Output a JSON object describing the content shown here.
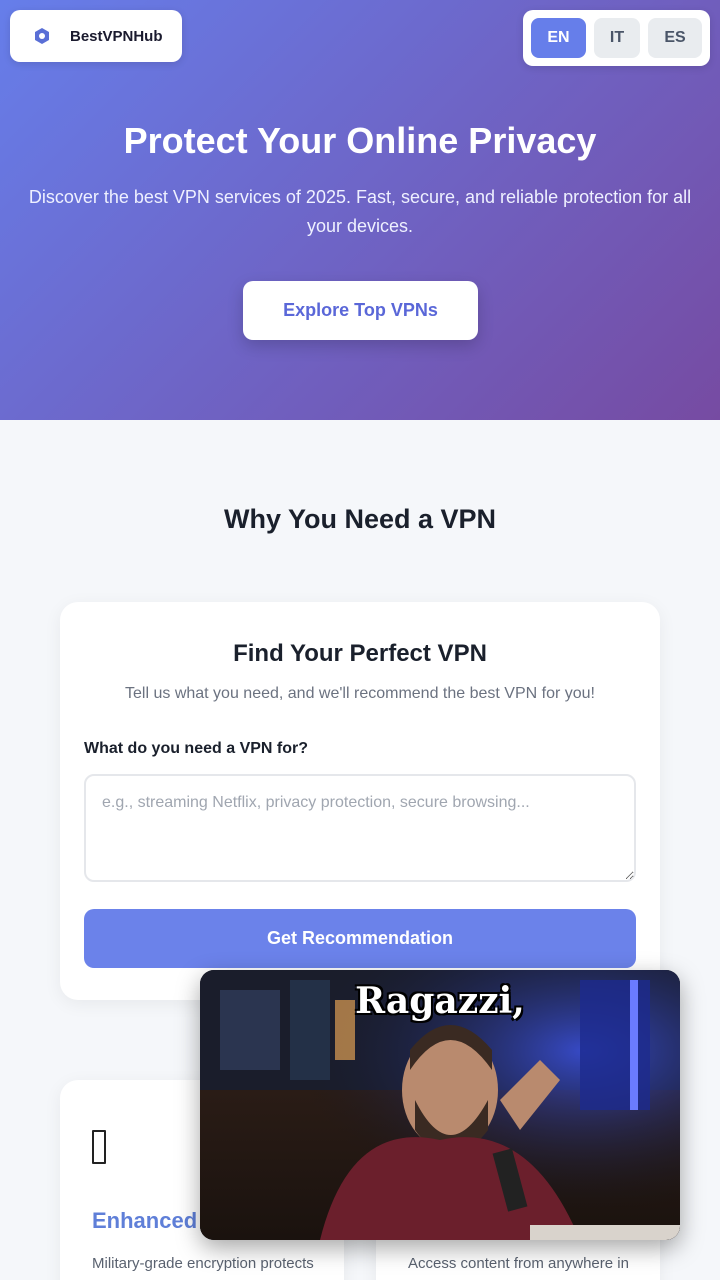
{
  "header": {
    "brand_name": "BestVPNHub",
    "logo_icon": "shield-icon",
    "languages": [
      "EN",
      "IT",
      "ES"
    ],
    "active_language": "EN"
  },
  "hero": {
    "title": "Protect Your Online Privacy",
    "subtitle": "Discover the best VPN services of 2025. Fast, secure, and reliable protection for all your devices.",
    "cta_label": "Explore Top VPNs"
  },
  "why_section": {
    "title": "Why You Need a VPN"
  },
  "finder": {
    "title": "Find Your Perfect VPN",
    "description": "Tell us what you need, and we'll recommend the best VPN for you!",
    "question_label": "What do you need a VPN for?",
    "input_placeholder": "e.g., streaming Netflix, privacy protection, secure browsing...",
    "input_value": "",
    "button_label": "Get Recommendation"
  },
  "features": [
    {
      "icon": "missing-glyph-icon",
      "title": "Enhanced",
      "description": "Military-grade encryption protects"
    },
    {
      "icon": "",
      "title": "",
      "description": "Access content from anywhere in"
    }
  ],
  "video_overlay": {
    "caption": "Ragazzi,"
  },
  "colors": {
    "gradient_start": "#667eea",
    "gradient_end": "#764ba2",
    "accent": "#667eea",
    "button": "#6b82ea",
    "feature_title": "#5f7fd8"
  }
}
